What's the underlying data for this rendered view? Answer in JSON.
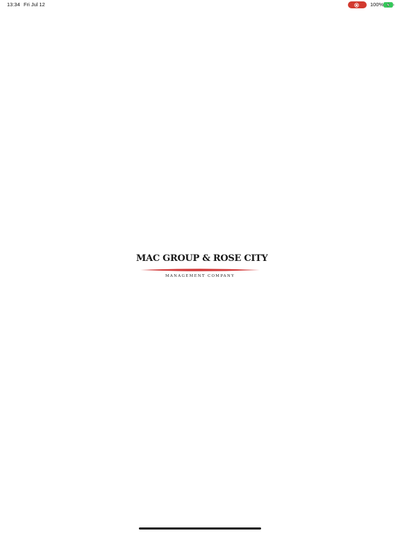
{
  "status_bar": {
    "time": "13:34",
    "date": "Fri Jul 12",
    "battery_percent": "100%",
    "record_indicator_icon": "screen-record-icon",
    "battery_icon": "battery-charging-icon",
    "colors": {
      "record_pill": "#d23a2f",
      "battery_fill": "#34c759"
    }
  },
  "logo": {
    "title": "MAC GROUP & ROSE CITY",
    "subtitle": "MANAGEMENT COMPANY",
    "swoosh_color": "#d23a3a"
  },
  "home_indicator": {
    "icon": "home-indicator-bar"
  }
}
